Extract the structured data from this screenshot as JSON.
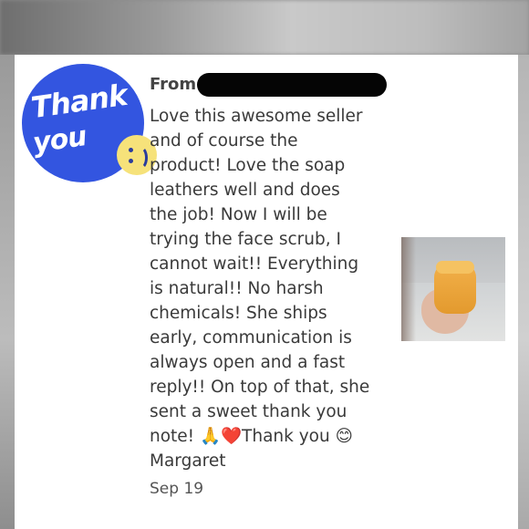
{
  "review": {
    "from_label": "From",
    "message": "Love this awesome seller\nand of course the\nproduct! Love the soap\nleathers well and does\nthe job! Now I will be\ntrying the face scrub, I\ncannot wait!! Everything\nis natural!! No harsh\nchemicals! She ships\nearly, communication is\nalways open and a fast\nreply!! On top of that, she\nsent a sweet thank you\nnote! 🙏❤️Thank you 😊\nMargaret",
    "date": "Sep 19"
  },
  "avatar": {
    "line1": "Thank",
    "line2": "you",
    "icon": "smiley-face-icon",
    "color": "#3355e0"
  },
  "photo": {
    "icon": "product-jar-photo"
  }
}
